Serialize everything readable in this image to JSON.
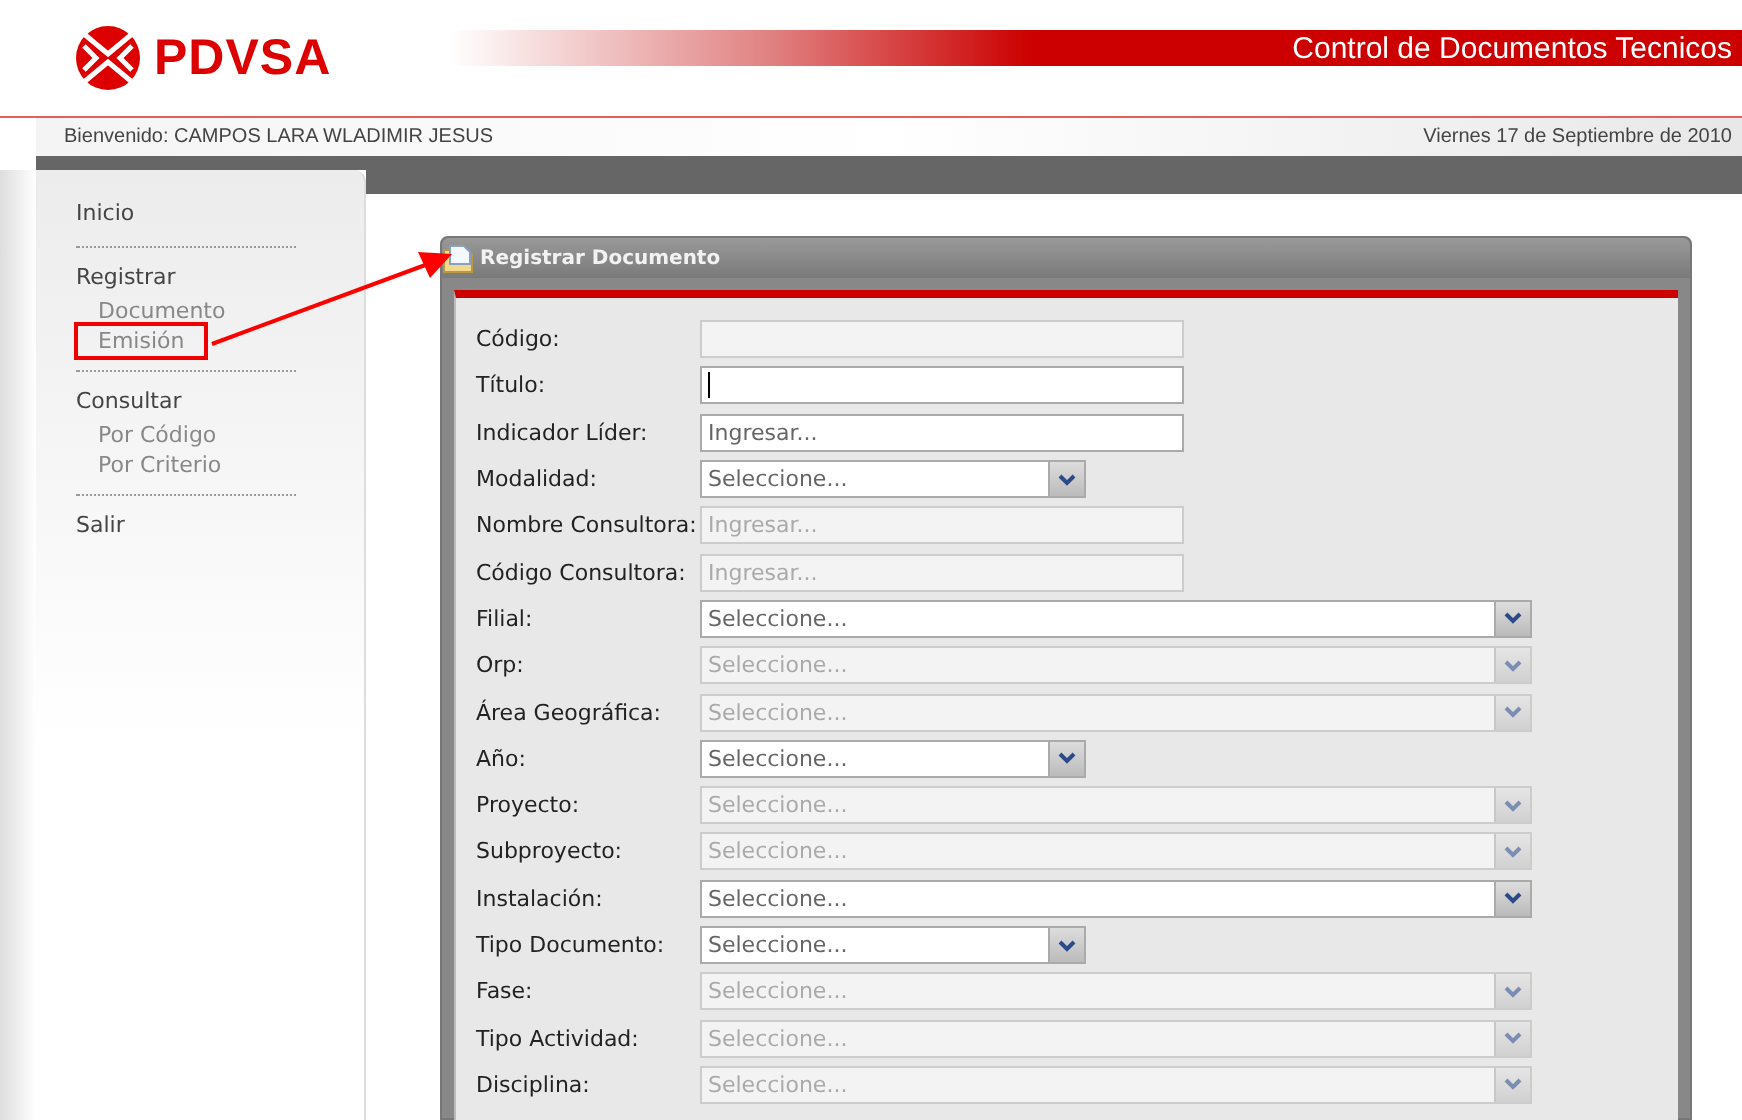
{
  "header": {
    "brand": "PDVSA",
    "app_title": "Control de Documentos Tecnicos"
  },
  "welcome_bar": {
    "user": "Bienvenido: CAMPOS LARA WLADIMIR JESUS",
    "date": "Viernes 17 de Septiembre de 2010"
  },
  "sidebar": {
    "groups": [
      {
        "label": "Inicio"
      },
      {
        "label": "Registrar",
        "children": [
          {
            "label": "Documento",
            "highlighted": false
          },
          {
            "label": "Emisión",
            "highlighted": true
          }
        ]
      },
      {
        "label": "Consultar",
        "children": [
          {
            "label": "Por Código",
            "highlighted": false
          },
          {
            "label": "Por Criterio",
            "highlighted": false
          }
        ]
      },
      {
        "label": "Salir"
      }
    ]
  },
  "form_window": {
    "title": "Registrar Documento",
    "fields": [
      {
        "label": "Código:",
        "kind": "text",
        "disabled": true,
        "focused": false
      },
      {
        "label": "Título:",
        "kind": "text",
        "disabled": false,
        "focused": true
      },
      {
        "label": "Indicador Líder:",
        "kind": "text",
        "disabled": false,
        "focused": false,
        "placeholder": "Ingresar..."
      },
      {
        "label": "Modalidad:",
        "kind": "select",
        "wide": false,
        "disabled": false,
        "placeholder": "Seleccione..."
      },
      {
        "label": "Nombre Consultora:",
        "kind": "text",
        "disabled": true,
        "focused": false,
        "placeholder": "Ingresar..."
      },
      {
        "label": "Código Consultora:",
        "kind": "text",
        "disabled": true,
        "focused": false,
        "placeholder": "Ingresar..."
      },
      {
        "label": "Filial:",
        "kind": "select",
        "wide": true,
        "disabled": false,
        "placeholder": "Seleccione..."
      },
      {
        "label": "Orp:",
        "kind": "select",
        "wide": true,
        "disabled": true,
        "placeholder": "Seleccione..."
      },
      {
        "label": "Área Geográfica:",
        "kind": "select",
        "wide": true,
        "disabled": true,
        "placeholder": "Seleccione..."
      },
      {
        "label": "Año:",
        "kind": "select",
        "wide": false,
        "disabled": false,
        "placeholder": "Seleccione..."
      },
      {
        "label": "Proyecto:",
        "kind": "select",
        "wide": true,
        "disabled": true,
        "placeholder": "Seleccione..."
      },
      {
        "label": "Subproyecto:",
        "kind": "select",
        "wide": true,
        "disabled": true,
        "placeholder": "Seleccione..."
      },
      {
        "label": "Instalación:",
        "kind": "select",
        "wide": true,
        "disabled": false,
        "placeholder": "Seleccione..."
      },
      {
        "label": "Tipo Documento:",
        "kind": "select",
        "wide": false,
        "disabled": false,
        "placeholder": "Seleccione..."
      },
      {
        "label": "Fase:",
        "kind": "select",
        "wide": true,
        "disabled": true,
        "placeholder": "Seleccione..."
      },
      {
        "label": "Tipo Actividad:",
        "kind": "select",
        "wide": true,
        "disabled": true,
        "placeholder": "Seleccione..."
      },
      {
        "label": "Disciplina:",
        "kind": "select",
        "wide": true,
        "disabled": true,
        "placeholder": "Seleccione..."
      }
    ]
  }
}
